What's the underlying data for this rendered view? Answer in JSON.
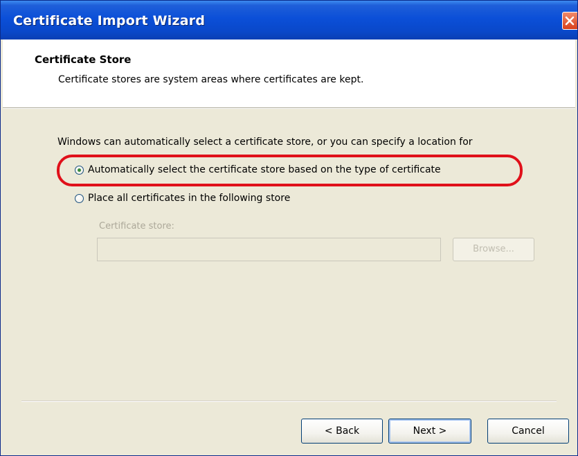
{
  "window": {
    "title": "Certificate Import Wizard"
  },
  "header": {
    "title": "Certificate Store",
    "subtitle": "Certificate stores are system areas where certificates are kept."
  },
  "body": {
    "intro": "Windows can automatically select a certificate store, or you can specify a location for",
    "options": [
      {
        "label": "Automatically select the certificate store based on the type of certificate",
        "checked": true
      },
      {
        "label": "Place all certificates in the following store",
        "checked": false
      }
    ],
    "store_label": "Certificate store:",
    "store_value": "",
    "browse_label": "Browse..."
  },
  "footer": {
    "back_label": "< Back",
    "next_label": "Next >",
    "cancel_label": "Cancel"
  },
  "colors": {
    "titlebar": "#0a4fd8",
    "highlight": "#e0101a",
    "dialog_bg": "#ece9d8"
  }
}
